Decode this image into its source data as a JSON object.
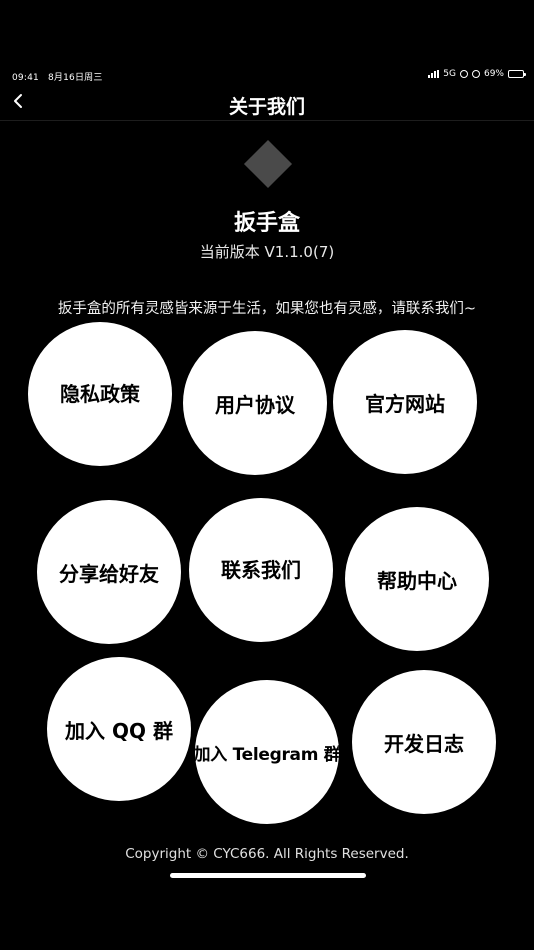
{
  "status_bar": {
    "time": "09:41",
    "date": "8月16日周三",
    "network": "5G",
    "battery": "69%",
    "battery_level": 0.69
  },
  "nav": {
    "back_icon": "chevron-left-icon",
    "title": "关于我们"
  },
  "app": {
    "logo_icon": "diamond-logo-icon",
    "name": "扳手盒",
    "version": "当前版本 V1.1.0(7)"
  },
  "tagline": "扳手盒的所有灵感皆来源于生活，如果您也有灵感，请联系我们~",
  "buttons": [
    {
      "label": "隐私政策"
    },
    {
      "label": "用户协议"
    },
    {
      "label": "官方网站"
    },
    {
      "label": "分享给好友"
    },
    {
      "label": "联系我们"
    },
    {
      "label": "帮助中心"
    },
    {
      "label": "加入 QQ 群"
    },
    {
      "label": "加入 Telegram 群"
    },
    {
      "label": "开发日志"
    }
  ],
  "footer": {
    "copyright": "Copyright © CYC666. All Rights Reserved."
  },
  "colors": {
    "background": "#000000",
    "text": "#ffffff",
    "button_bg": "#ffffff",
    "button_text": "#000000",
    "logo": "#4a4a4a"
  }
}
